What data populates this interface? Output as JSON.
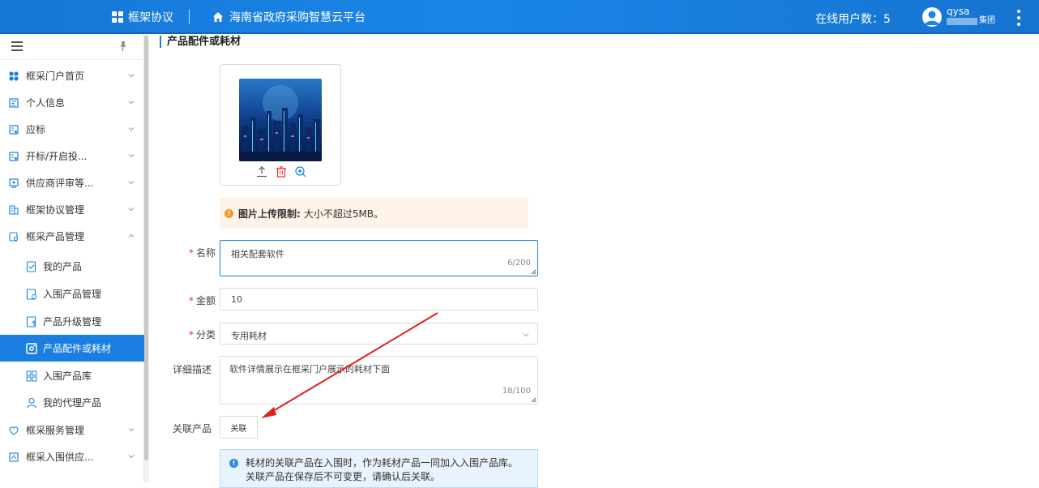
{
  "header": {
    "brand": "框架协议",
    "platform": "海南省政府采购智慧云平台",
    "online_label": "在线用户数：",
    "online_count": "5",
    "user_name": "qysa",
    "user_org_suffix": "集团"
  },
  "sidebar": {
    "items": [
      {
        "label": "框采门户首页",
        "icon": "apps-icon"
      },
      {
        "label": "个人信息",
        "icon": "id-card-icon"
      },
      {
        "label": "应标",
        "icon": "doc-icon"
      },
      {
        "label": "开标/开启投...",
        "icon": "doc-icon"
      },
      {
        "label": "供应商评审等...",
        "icon": "monitor-icon"
      },
      {
        "label": "框架协议管理",
        "icon": "contract-icon"
      },
      {
        "label": "框采产品管理",
        "icon": "product-icon"
      },
      {
        "label": "我的产品",
        "icon": "box-check-icon"
      },
      {
        "label": "入围产品管理",
        "icon": "doc-gear-icon"
      },
      {
        "label": "产品升级管理",
        "icon": "upgrade-icon"
      },
      {
        "label": "产品配件或耗材",
        "icon": "parts-icon"
      },
      {
        "label": "入围产品库",
        "icon": "grid-icon"
      },
      {
        "label": "我的代理产品",
        "icon": "user-icon"
      },
      {
        "label": "框采服务管理",
        "icon": "service-icon"
      },
      {
        "label": "框采入围供应...",
        "icon": "supplier-icon"
      }
    ]
  },
  "main": {
    "section_title": "产品配件或耗材",
    "upload_tip_label": "图片上传限制:",
    "upload_tip_text": "大小不超过5MB。",
    "name_label": "名称",
    "name_value": "相关配套软件",
    "name_count": "6/200",
    "amount_label": "金额",
    "amount_value": "10",
    "category_label": "分类",
    "category_value": "专用耗材",
    "desc_label": "详细描述",
    "desc_value": "软件详情展示在框采门户展示的耗材下面",
    "desc_count": "18/100",
    "related_label": "关联产品",
    "related_button": "关联",
    "info_line1": "耗材的关联产品在入围时，作为耗材产品一同加入入围产品库。",
    "info_line2": "关联产品在保存后不可变更，请确认后关联。"
  },
  "colors": {
    "header": "#1a86e8",
    "active": "#1a7fe0",
    "required": "#ee3333",
    "annotation_arrow": "#e02020"
  }
}
